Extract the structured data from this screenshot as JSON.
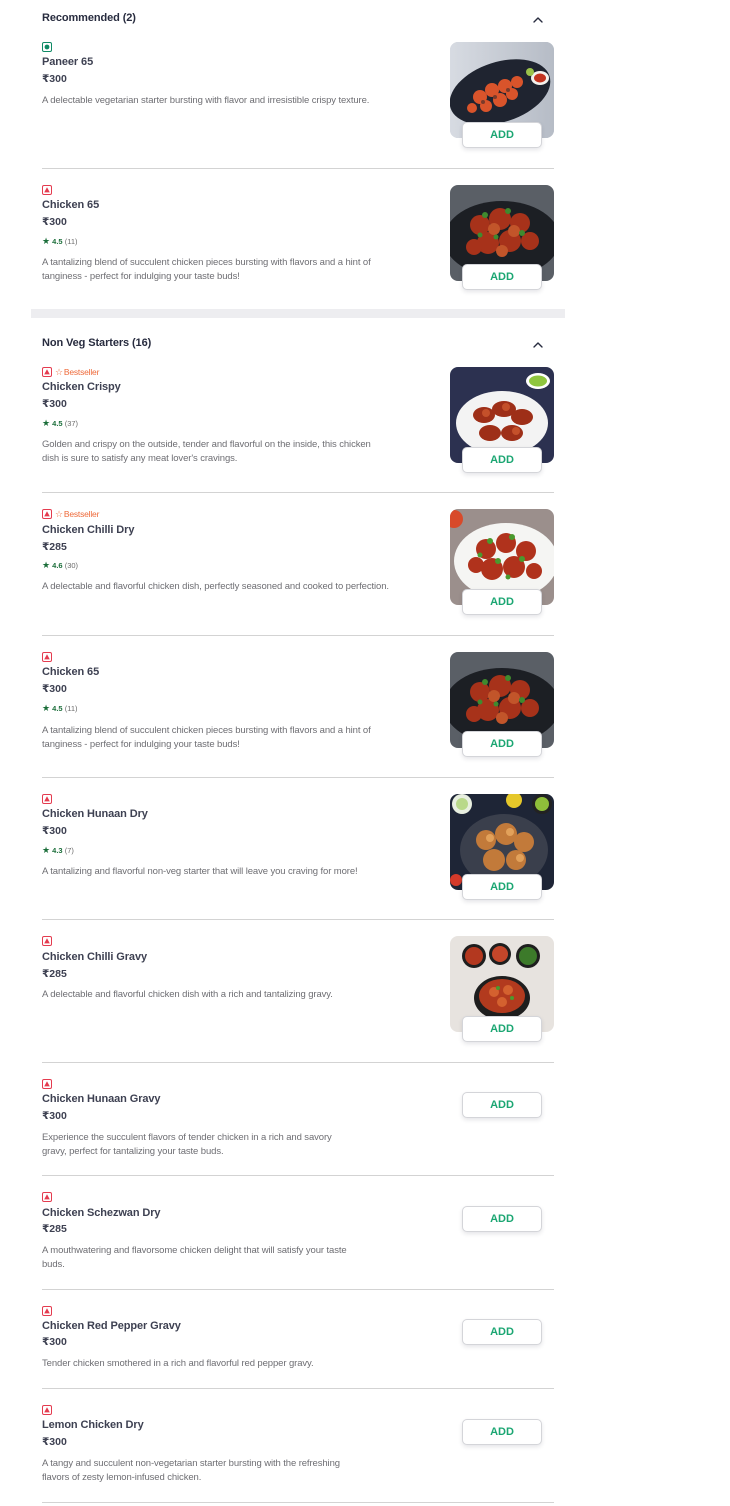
{
  "sections": {
    "recommended": {
      "title": "Recommended (2)"
    },
    "nonveg": {
      "title": "Non Veg Starters (16)"
    }
  },
  "buttons": {
    "add_label": "ADD"
  },
  "badges": {
    "bestseller": "Bestseller",
    "star_glyph": "★",
    "bestseller_glyph": "☆"
  },
  "colors": {
    "veg": "#0f8a65",
    "nonveg": "#e43b4f",
    "add_text": "#1ba672",
    "rating": "#1b6e3a",
    "bestseller": "#ee6a3a"
  },
  "items": [
    {
      "name": "Paneer 65",
      "price": "₹300",
      "desc": "A delectable vegetarian starter bursting with flavor and irresistible crispy texture.",
      "type": "veg",
      "image": "paneer-65-image"
    },
    {
      "name": "Chicken 65",
      "price": "₹300",
      "rating": "4.5",
      "rating_count": "(11)",
      "desc": "A tantalizing blend of succulent chicken pieces bursting with flavors and a hint of tanginess - perfect for indulging your taste buds!",
      "type": "nonveg",
      "image": "chicken-65-image"
    },
    {
      "name": "Chicken Crispy",
      "price": "₹300",
      "rating": "4.5",
      "rating_count": "(37)",
      "bestseller": true,
      "desc": "Golden and crispy on the outside, tender and flavorful on the inside, this chicken dish is sure to satisfy any meat lover's cravings.",
      "type": "nonveg",
      "image": "chicken-crispy-image"
    },
    {
      "name": "Chicken Chilli Dry",
      "price": "₹285",
      "rating": "4.6",
      "rating_count": "(30)",
      "bestseller": true,
      "desc": "A delectable and flavorful chicken dish, perfectly seasoned and cooked to perfection.",
      "type": "nonveg",
      "image": "chicken-chilli-dry-image"
    },
    {
      "name": "Chicken 65",
      "price": "₹300",
      "rating": "4.5",
      "rating_count": "(11)",
      "desc": "A tantalizing blend of succulent chicken pieces bursting with flavors and a hint of tanginess - perfect for indulging your taste buds!",
      "type": "nonveg",
      "image": "chicken-65-image"
    },
    {
      "name": "Chicken Hunaan Dry",
      "price": "₹300",
      "rating": "4.3",
      "rating_count": "(7)",
      "desc": "A tantalizing and flavorful non-veg starter that will leave you craving for more!",
      "type": "nonveg",
      "image": "chicken-hunaan-dry-image"
    },
    {
      "name": "Chicken Chilli Gravy",
      "price": "₹285",
      "desc": "A delectable and flavorful chicken dish with a rich and tantalizing gravy.",
      "type": "nonveg",
      "image": "chicken-chilli-gravy-image"
    },
    {
      "name": "Chicken Hunaan Gravy",
      "price": "₹300",
      "desc": "Experience the succulent flavors of tender chicken in a rich and savory gravy, perfect for tantalizing your taste buds.",
      "type": "nonveg"
    },
    {
      "name": "Chicken Schezwan Dry",
      "price": "₹285",
      "desc": "A mouthwatering and flavorsome chicken delight that will satisfy your taste buds.",
      "type": "nonveg"
    },
    {
      "name": "Chicken Red Pepper Gravy",
      "price": "₹300",
      "desc": "Tender chicken smothered in a rich and flavorful red pepper gravy.",
      "type": "nonveg"
    },
    {
      "name": "Lemon Chicken Dry",
      "price": "₹300",
      "desc": "A tangy and succulent non-vegetarian starter bursting with the refreshing flavors of zesty lemon-infused chicken.",
      "type": "nonveg"
    }
  ]
}
